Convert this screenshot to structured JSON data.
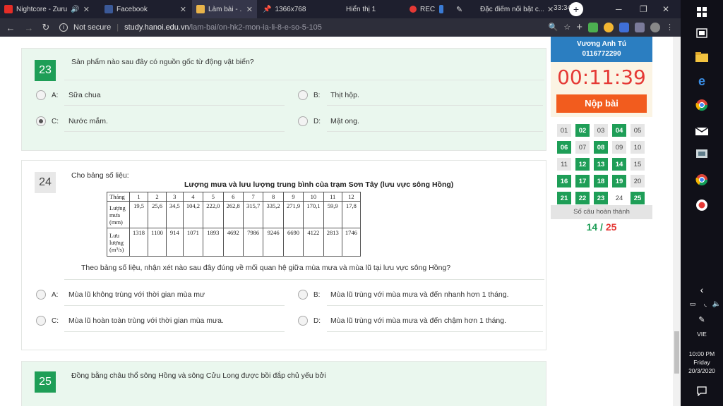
{
  "browser": {
    "tabs": [
      {
        "title": "Nightcore - Zuru",
        "active": false
      },
      {
        "title": "Facebook",
        "active": false
      },
      {
        "title": "Làm bài - .",
        "active": true
      },
      {
        "title": "1366x768",
        "active": false
      },
      {
        "title": "Hiển thị 1",
        "active": false
      },
      {
        "title": "REC",
        "active": false
      },
      {
        "title": "Đặc điểm nổi bật c...",
        "active": false
      }
    ],
    "overlay_timer": "33:34",
    "security_label": "Not secure",
    "url_domain": "study.hanoi.edu.vn",
    "url_path": "/lam-bai/on-hk2-mon-ia-li-8-e-so-5-105"
  },
  "questions": {
    "q23": {
      "number": "23",
      "text": "Sản phẩm nào sau đây có nguồn gốc từ động vật biển?",
      "options": [
        {
          "letter": "A:",
          "text": "Sữa chua",
          "checked": false
        },
        {
          "letter": "B:",
          "text": "Thịt hộp.",
          "checked": false
        },
        {
          "letter": "C:",
          "text": "Nước mắm.",
          "checked": true
        },
        {
          "letter": "D:",
          "text": "Mật ong.",
          "checked": false
        }
      ]
    },
    "q24": {
      "number": "24",
      "intro": "Cho bảng số liệu:",
      "table_title": "Lượng mưa và lưu lượng trung bình của trạm Sơn Tây (lưu vực sông Hồng)",
      "table": {
        "month_label": "Tháng",
        "months": [
          "1",
          "2",
          "3",
          "4",
          "5",
          "6",
          "7",
          "8",
          "9",
          "10",
          "11",
          "12"
        ],
        "rain_label": [
          "Lượng",
          "mưa",
          "(mm)"
        ],
        "rain": [
          "19,5",
          "25,6",
          "34,5",
          "104,2",
          "222,0",
          "262,8",
          "315,7",
          "335,2",
          "271,9",
          "170,1",
          "59,9",
          "17,8"
        ],
        "flow_label": [
          "Lưu",
          "lượng",
          "(m³/s)"
        ],
        "flow": [
          "1318",
          "1100",
          "914",
          "1071",
          "1893",
          "4692",
          "7986",
          "9246",
          "6690",
          "4122",
          "2813",
          "1746"
        ]
      },
      "text": "Theo bảng số liệu, nhận xét nào sau đây đúng về mối quan hệ giữa mùa mưa và mùa lũ tại lưu vực sông Hồng?",
      "options": [
        {
          "letter": "A:",
          "text": "Mùa lũ không trùng với thời gian mùa mư",
          "checked": false
        },
        {
          "letter": "B:",
          "text": "Mùa lũ trùng với mùa mưa và đến nhanh hơn 1 tháng.",
          "checked": false
        },
        {
          "letter": "C:",
          "text": "Mùa lũ hoàn toàn trùng với thời gian mùa mưa.",
          "checked": false
        },
        {
          "letter": "D:",
          "text": "Mùa lũ trùng với mùa mưa và đến chậm hơn 1 tháng.",
          "checked": false
        }
      ]
    },
    "q25": {
      "number": "25",
      "text": "Đồng bằng châu thổ sông Hồng và sông Cửu Long được bồi đắp chủ yếu bởi"
    }
  },
  "sidebar": {
    "student_name": "Vương Anh Tú",
    "student_id": "0116772290",
    "timer": "00:11:39",
    "submit_label": "Nộp bài",
    "grid": [
      {
        "n": "01",
        "s": "todo"
      },
      {
        "n": "02",
        "s": "done"
      },
      {
        "n": "03",
        "s": "todo"
      },
      {
        "n": "04",
        "s": "done"
      },
      {
        "n": "05",
        "s": "todo"
      },
      {
        "n": "06",
        "s": "done"
      },
      {
        "n": "07",
        "s": "todo"
      },
      {
        "n": "08",
        "s": "done"
      },
      {
        "n": "09",
        "s": "todo"
      },
      {
        "n": "10",
        "s": "todo"
      },
      {
        "n": "11",
        "s": "todo"
      },
      {
        "n": "12",
        "s": "done"
      },
      {
        "n": "13",
        "s": "done"
      },
      {
        "n": "14",
        "s": "done"
      },
      {
        "n": "15",
        "s": "todo"
      },
      {
        "n": "16",
        "s": "done"
      },
      {
        "n": "17",
        "s": "done"
      },
      {
        "n": "18",
        "s": "done"
      },
      {
        "n": "19",
        "s": "done"
      },
      {
        "n": "20",
        "s": "todo"
      },
      {
        "n": "21",
        "s": "done"
      },
      {
        "n": "22",
        "s": "done"
      },
      {
        "n": "23",
        "s": "done"
      },
      {
        "n": "24",
        "s": "cur"
      },
      {
        "n": "25",
        "s": "done"
      }
    ],
    "completed_label": "Số câu hoàn thành",
    "completed": "14",
    "separator": "/",
    "total": "25"
  },
  "taskbar": {
    "language": "VIE",
    "time": "10:00 PM",
    "day": "Friday",
    "date": "20/3/2020"
  },
  "colors": {
    "accent_green": "#1e9e57",
    "timer_red": "#e53935",
    "submit_orange": "#f25c1e",
    "header_blue": "#2b7ec1"
  }
}
